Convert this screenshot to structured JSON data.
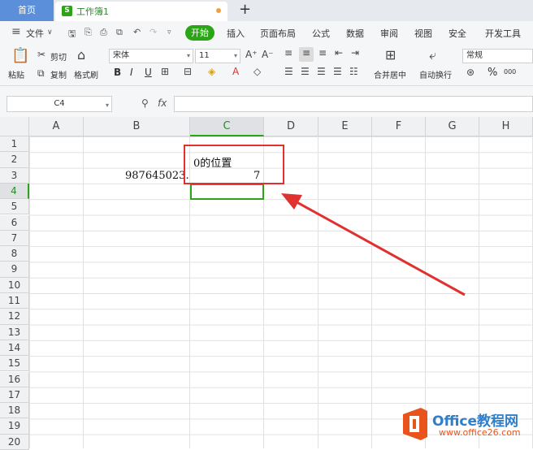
{
  "tabs": {
    "home": "首页",
    "document": "工作簿1",
    "doc_icon": "S",
    "new_tab": "+"
  },
  "menu": {
    "file": "文件",
    "start": "开始",
    "items": [
      "插入",
      "页面布局",
      "公式",
      "数据",
      "审阅",
      "视图",
      "安全",
      "开发工具"
    ]
  },
  "ribbon": {
    "paste": "粘贴",
    "cut": "剪切",
    "copy": "复制",
    "format_painter": "格式刷",
    "font_name": "宋体",
    "font_size": "11",
    "bold": "B",
    "italic": "I",
    "underline": "U",
    "merge_center": "合并居中",
    "wrap_text": "自动换行",
    "number_format": "常规",
    "percent": "%",
    "thousands": "000"
  },
  "formula_bar": {
    "name_box": "C4",
    "fx": "fx",
    "value": ""
  },
  "sheet": {
    "columns": [
      "A",
      "B",
      "C",
      "D",
      "E",
      "F",
      "G",
      "H"
    ],
    "rows": [
      "1",
      "2",
      "3",
      "4",
      "5",
      "6",
      "7",
      "8",
      "9",
      "10",
      "11",
      "12",
      "13",
      "14",
      "15",
      "16",
      "17",
      "18",
      "19",
      "20"
    ],
    "selected_column": "C",
    "selected_row": "4",
    "cells": {
      "B3": "987645023.",
      "C2": "0的位置",
      "C3": "7"
    }
  },
  "colors": {
    "accent": "#2aa515",
    "annotation": "#e03030",
    "tab_home": "#5b8fd9"
  },
  "watermark": {
    "brand": "Office教程网",
    "url": "www.office26.com"
  }
}
